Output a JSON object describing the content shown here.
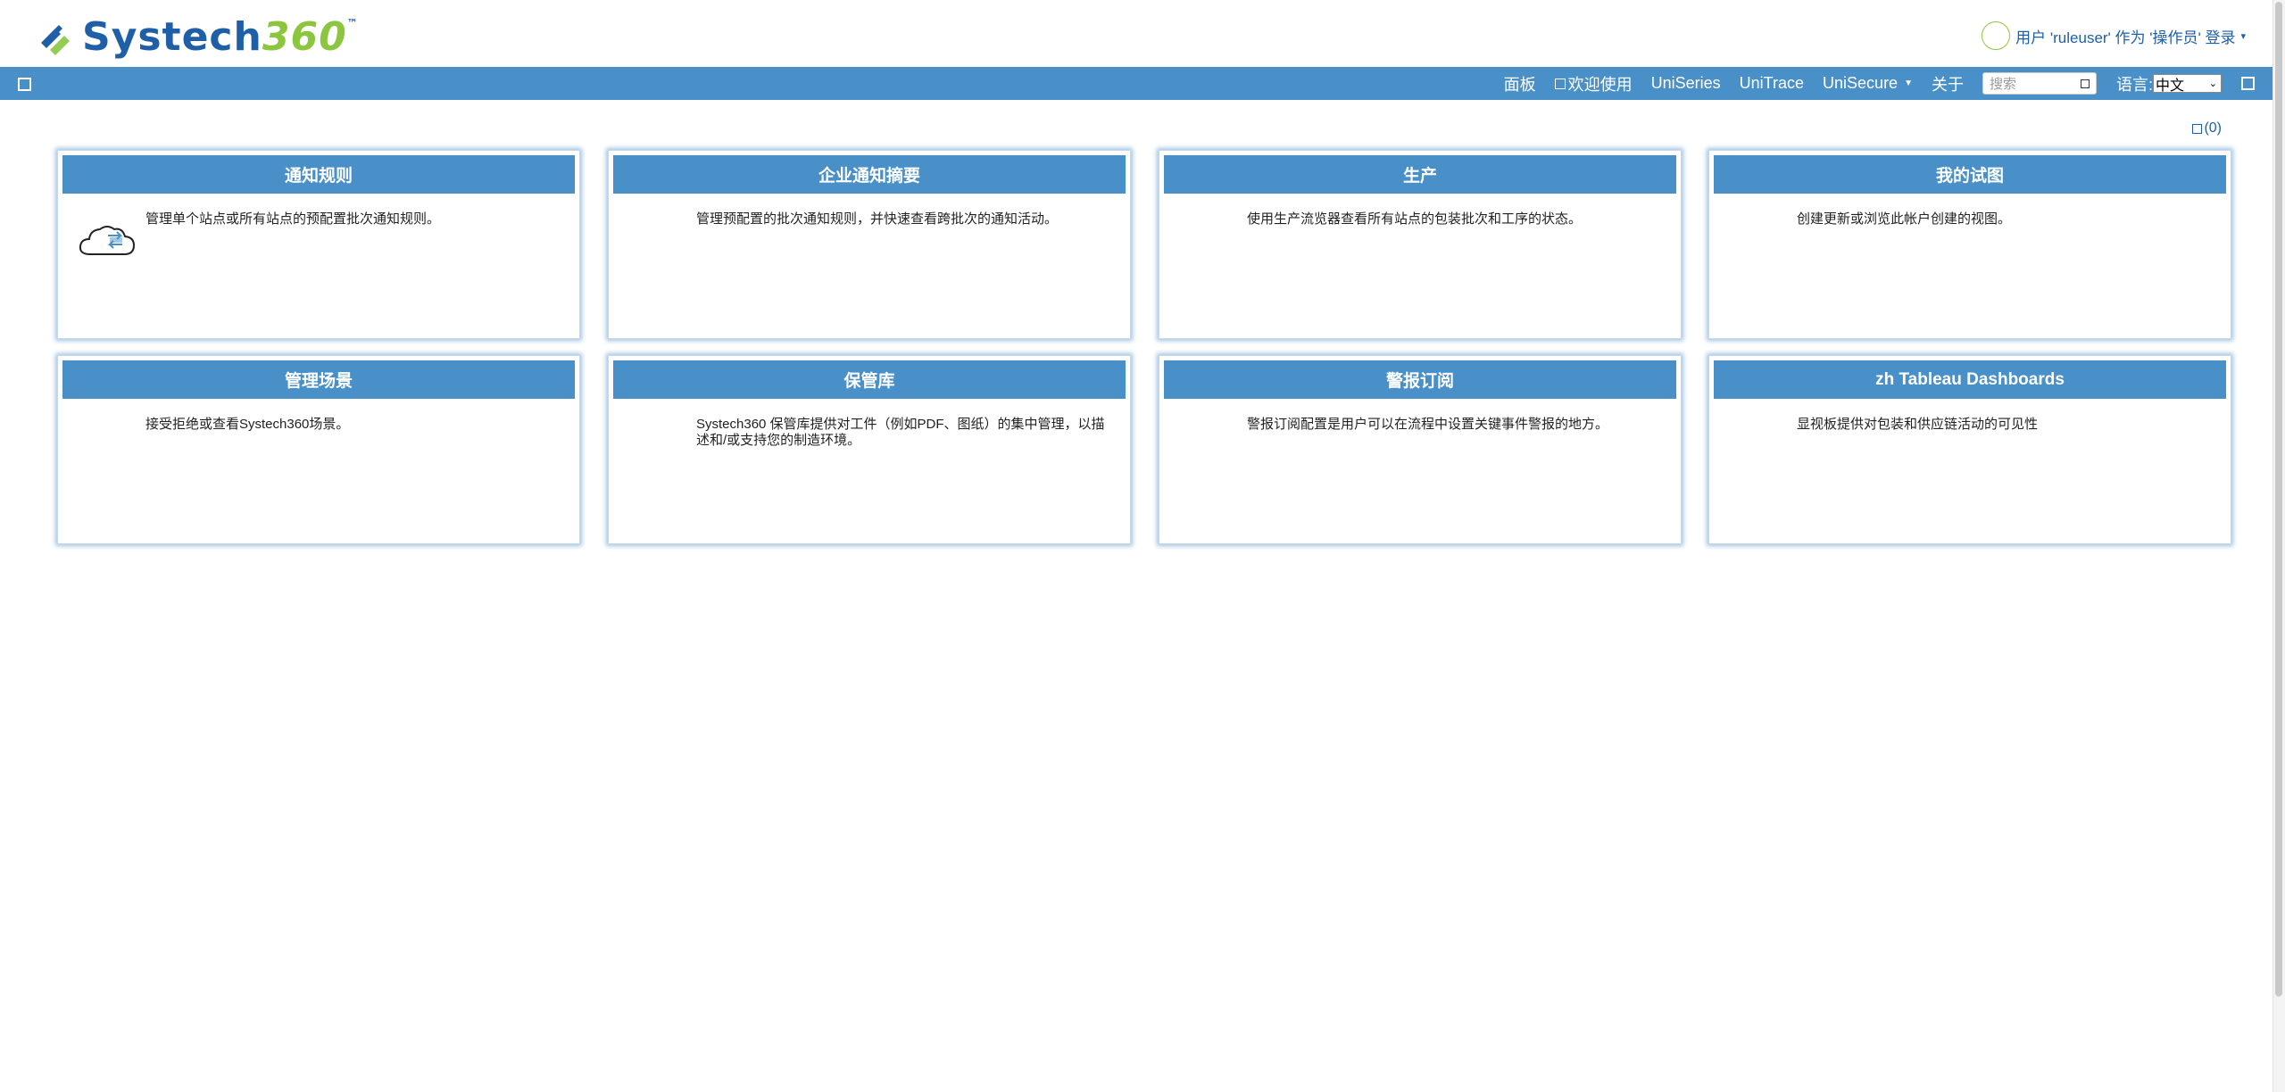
{
  "header": {
    "logo_part1": "Systech",
    "logo_part2": "360",
    "logo_tm": "™",
    "user_text": "用户 'ruleuser' 作为 '操作员' 登录"
  },
  "nav": {
    "items": [
      "面板",
      "欢迎使用",
      "UniSeries",
      "UniTrace",
      "UniSecure",
      "关于"
    ],
    "search_placeholder": "搜索",
    "language_label": "语言:",
    "language_value": "中文"
  },
  "notifications": {
    "count_text": "(0)"
  },
  "cards": [
    {
      "title": "通知规则",
      "desc": "管理单个站点或所有站点的预配置批次通知规则。",
      "icon": "cloud-sync-icon"
    },
    {
      "title": "企业通知摘要",
      "desc": "管理预配置的批次通知规则，并快速查看跨批次的通知活动。"
    },
    {
      "title": "生产",
      "desc": "使用生产流览器查看所有站点的包装批次和工序的状态。"
    },
    {
      "title": "我的试图",
      "desc": "创建更新或浏览此帐户创建的视图。"
    },
    {
      "title": "管理场景",
      "desc": "接受拒绝或查看Systech360场景。"
    },
    {
      "title": "保管库",
      "desc": "Systech360 保管库提供对工件（例如PDF、图纸）的集中管理，以描述和/或支持您的制造环境。"
    },
    {
      "title": "警报订阅",
      "desc": "警报订阅配置是用户可以在流程中设置关键事件警报的地方。"
    },
    {
      "title": "zh Tableau Dashboards",
      "desc": "显视板提供对包装和供应链活动的可见性"
    }
  ],
  "colors": {
    "brand_blue": "#1f5fa8",
    "brand_green": "#8cc63f",
    "nav_bg": "#4a90c8"
  }
}
